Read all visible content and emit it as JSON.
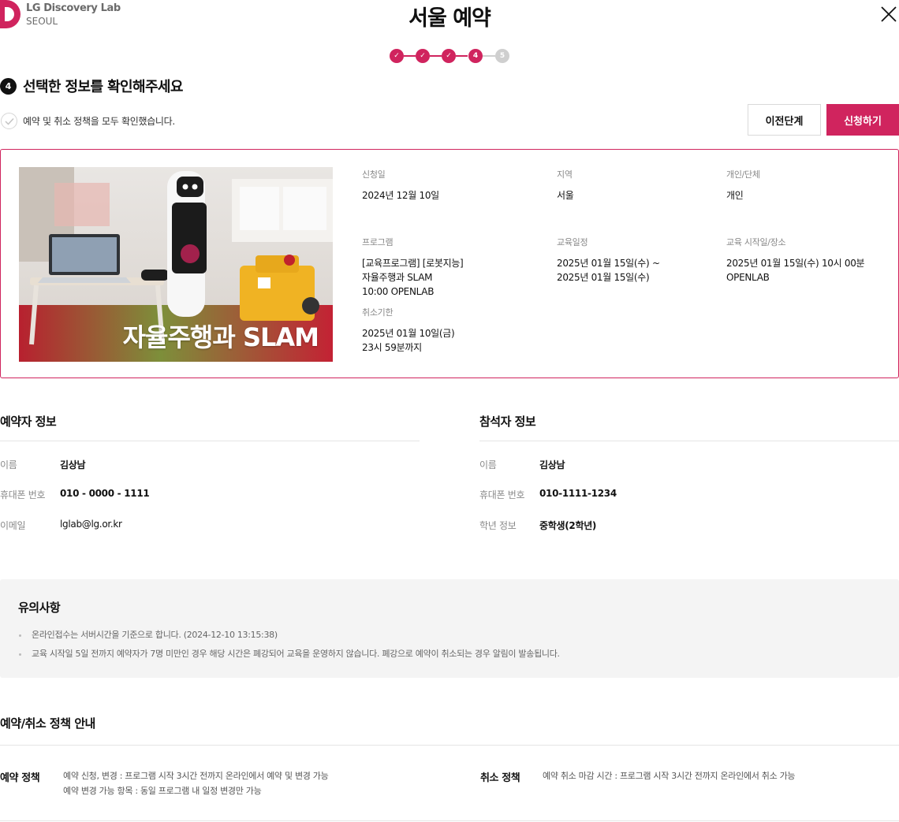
{
  "brand": {
    "name": "LG Discovery Lab",
    "city": "SEOUL",
    "accent": "#d0245e"
  },
  "page": {
    "title": "서울 예약"
  },
  "steps": {
    "items": [
      "✓",
      "✓",
      "✓",
      "4",
      "5"
    ],
    "current": 4,
    "done_color": "#d0245e",
    "todo_color": "#cfcfcf"
  },
  "section": {
    "number": "4",
    "title": "선택한 정보를 확인해주세요"
  },
  "agreement": {
    "label": "예약 및 취소 정책을 모두 확인했습니다.",
    "checked": false
  },
  "buttons": {
    "prev": "이전단계",
    "submit": "신청하기"
  },
  "program": {
    "thumbnail_title": "자율주행과 SLAM",
    "fields": {
      "apply_date": {
        "label": "신청일",
        "lines": [
          "2024년 12월 10일"
        ]
      },
      "region": {
        "label": "지역",
        "lines": [
          "서울"
        ]
      },
      "type": {
        "label": "개인/단체",
        "lines": [
          "개인"
        ]
      },
      "program": {
        "label": "프로그램",
        "lines": [
          "[교육프로그램] [로봇지능]",
          "자율주행과 SLAM",
          "10:00 OPENLAB"
        ]
      },
      "schedule": {
        "label": "교육일정",
        "lines": [
          "2025년 01월 15일(수) ~",
          "2025년 01월 15일(수)"
        ]
      },
      "start_place": {
        "label": "교육 시작일/장소",
        "lines": [
          "2025년 01월 15일(수) 10시 00분",
          "OPENLAB"
        ]
      },
      "cancel_deadline": {
        "label": "취소기한",
        "lines": [
          "2025년 01월 10일(금)",
          "23시 59분까지"
        ]
      }
    }
  },
  "reserver": {
    "title": "예약자 정보",
    "rows": [
      {
        "key": "이름",
        "value": "김상남"
      },
      {
        "key": "휴대폰 번호",
        "value": "010 - 0000 - 1111"
      },
      {
        "key": "이메일",
        "value": "lglab@lg.or.kr"
      }
    ]
  },
  "attendee": {
    "title": "참석자 정보",
    "rows": [
      {
        "key": "이름",
        "value": "김상남"
      },
      {
        "key": "휴대폰 번호",
        "value": "010-1111-1234"
      },
      {
        "key": "학년 정보",
        "value": "중학생(2학년)"
      }
    ]
  },
  "notice": {
    "title": "유의사항",
    "items": [
      "온라인접수는 서버시간을 기준으로 합니다. (2024-12-10 13:15:38)",
      "교육 시작일 5일 전까지 예약자가 7명 미만인 경우 해당 시간은 폐강되어 교육을 운영하지 않습니다. 폐강으로 예약이 취소되는 경우 알림이 발송됩니다."
    ]
  },
  "policy": {
    "title": "예약/취소 정책 안내",
    "reservation": {
      "label": "예약 정책",
      "lines": [
        "예약 신청, 변경 : 프로그램 시작 3시간 전까지 온라인에서 예약  및 변경 가능",
        "예약 변경 가능 항목 : 동일 프로그램 내 일정 변경만 가능"
      ]
    },
    "cancellation": {
      "label": "취소 정책",
      "lines": [
        "예약 취소 마감 시간 : 프로그램 시작 3시간 전까지 온라인에서 취소 가능"
      ]
    }
  }
}
